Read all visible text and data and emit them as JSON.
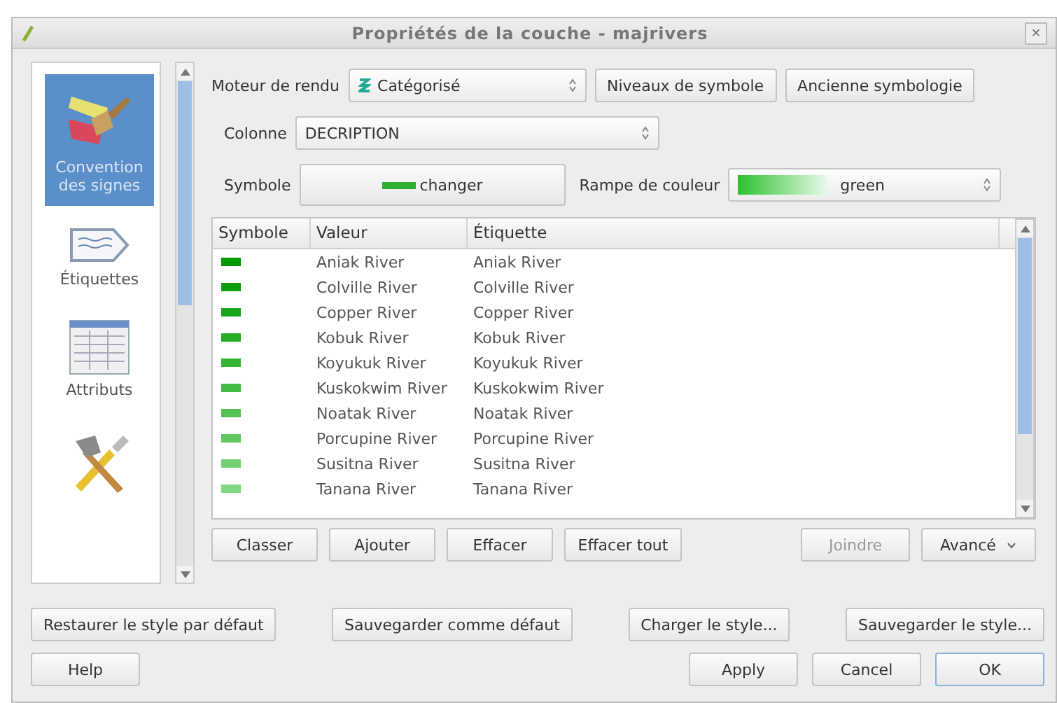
{
  "window": {
    "title": "Propriétés de la couche - majrivers",
    "close": "×"
  },
  "sidebar": {
    "items": [
      {
        "label": "Convention des signes",
        "selected": true,
        "kind": "brush"
      },
      {
        "label": "Étiquettes",
        "selected": false,
        "kind": "label"
      },
      {
        "label": "Attributs",
        "selected": false,
        "kind": "table"
      },
      {
        "selected": false,
        "kind": "tools"
      }
    ]
  },
  "renderer": {
    "label": "Moteur de rendu",
    "value": "Catégorisé",
    "buttons": [
      "Niveaux de symbole",
      "Ancienne symbologie"
    ]
  },
  "column": {
    "label": "Colonne",
    "value": "DECRIPTION"
  },
  "symbol": {
    "label": "Symbole",
    "button": "changer",
    "color": "#2fae2f"
  },
  "ramp": {
    "label": "Rampe de couleur",
    "value": "green"
  },
  "table": {
    "columns": [
      "Symbole",
      "Valeur",
      "Étiquette"
    ],
    "rows": [
      {
        "color": "#009a00",
        "value": "Aniak River",
        "label": "Aniak River"
      },
      {
        "color": "#0ba00b",
        "value": "Colville River",
        "label": "Colville River"
      },
      {
        "color": "#17a617",
        "value": "Copper River",
        "label": "Copper River"
      },
      {
        "color": "#25ad25",
        "value": "Kobuk River",
        "label": "Kobuk River"
      },
      {
        "color": "#33b433",
        "value": "Koyukuk River",
        "label": "Koyukuk River"
      },
      {
        "color": "#43bb43",
        "value": "Kuskokwim River",
        "label": "Kuskokwim River"
      },
      {
        "color": "#52c252",
        "value": "Noatak River",
        "label": "Noatak River"
      },
      {
        "color": "#62c962",
        "value": "Porcupine River",
        "label": "Porcupine River"
      },
      {
        "color": "#72d072",
        "value": "Susitna River",
        "label": "Susitna River"
      },
      {
        "color": "#82d782",
        "value": "Tanana River",
        "label": "Tanana River"
      }
    ]
  },
  "table_buttons": [
    {
      "label": "Classer",
      "disabled": false
    },
    {
      "label": "Ajouter",
      "disabled": false
    },
    {
      "label": "Effacer",
      "disabled": false
    },
    {
      "label": "Effacer tout",
      "disabled": false
    }
  ],
  "join": {
    "label": "Joindre",
    "disabled": true
  },
  "advanced": {
    "label": "Avancé"
  },
  "style_buttons": [
    "Restaurer le style par défaut",
    "Sauvegarder comme défaut",
    "Charger le style...",
    "Sauvegarder le style..."
  ],
  "dialog_buttons": [
    {
      "label": "Help",
      "default": false
    },
    {
      "label": "Apply",
      "default": false
    },
    {
      "label": "Cancel",
      "default": false
    },
    {
      "label": "OK",
      "default": true
    }
  ]
}
